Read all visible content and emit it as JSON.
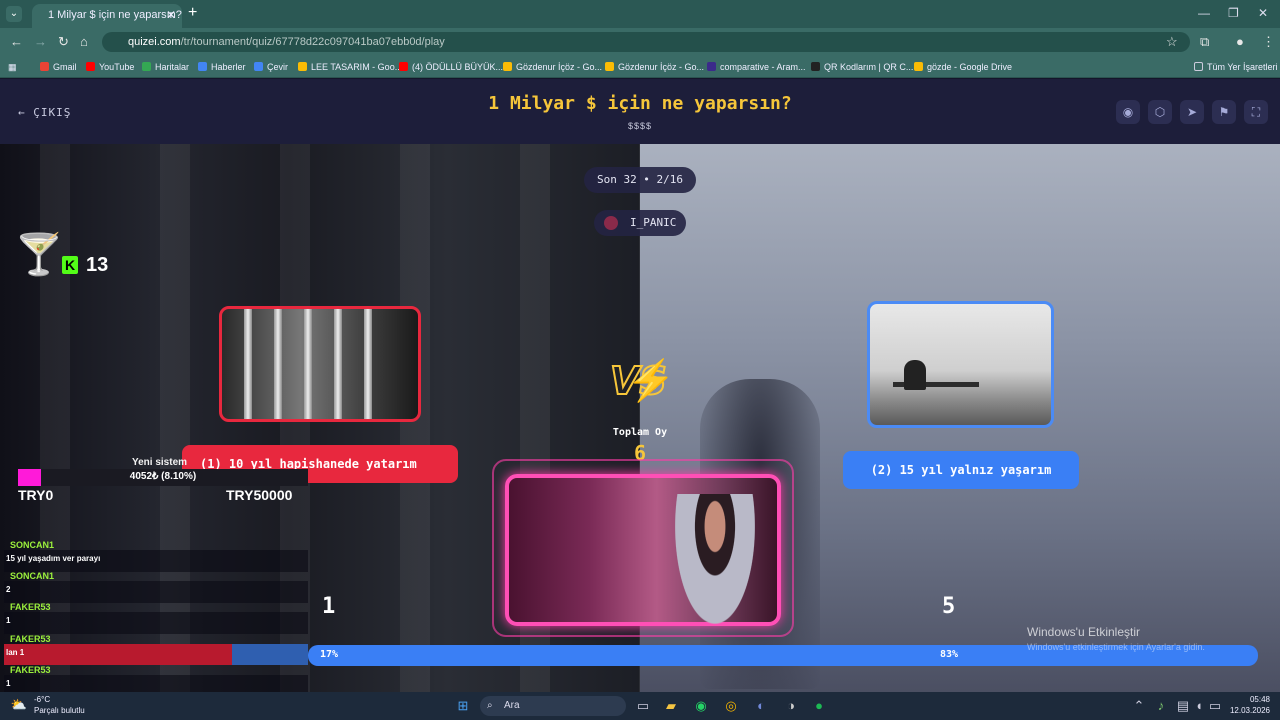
{
  "browser": {
    "tab_title": "1 Milyar $ için ne yaparsın? - Ti",
    "tab_close": "✕",
    "new_tab": "+",
    "url_host": "quizei.com",
    "url_path": "/tr/tournament/quiz/67778d22c097041ba07ebb0d/play",
    "bookmarks": [
      "Gmail",
      "YouTube",
      "Haritalar",
      "Haberler",
      "Çevir",
      "LEE TASARIM - Goo...",
      "(4) ÖDÜLLÜ BÜYÜK...",
      "Gözdenur İçöz - Go...",
      "Gözdenur İçöz - Go...",
      "comparative - Aram...",
      "QR Kodlarım | QR C...",
      "gözde - Google Drive"
    ],
    "all_bookmarks": "Tüm Yer İşaretleri"
  },
  "header": {
    "exit_label": "ÇIKIŞ",
    "title": "1 Milyar $ için ne yaparsın?",
    "subtitle": "$$$$"
  },
  "round": {
    "label": "Son 32 • 2/16",
    "player": "I_PANIC"
  },
  "vs": {
    "text": "VS",
    "total_label": "Toplam Oy",
    "total_value": "6"
  },
  "options": {
    "left_label": "(1) 10 yıl hapishanede yatarım",
    "right_label": "(2) 15 yıl yalnız yaşarım",
    "left_votes": "1",
    "right_votes": "5",
    "left_pct": "17%",
    "right_pct": "83%",
    "left_fraction": 0.17
  },
  "stream_overlay": {
    "kick_count": "13",
    "donate_title": "Yeni sistem",
    "donate_text": "4052₺ (8.10%)",
    "donate_fraction": 0.081,
    "min_label": "TRY0",
    "max_label": "TRY50000",
    "chat": [
      {
        "user": "SONCAN1",
        "msg": "15 yıl yaşadım ver parayı"
      },
      {
        "user": "SONCAN1",
        "msg": "2"
      },
      {
        "user": "FAKER53",
        "msg": "1"
      },
      {
        "user": "FAKER53",
        "msg": "lan 1"
      },
      {
        "user": "FAKER53",
        "msg": "1"
      }
    ]
  },
  "windows": {
    "activate_title": "Windows'u Etkinleştir",
    "activate_sub": "Windows'u etkinleştirmek için Ayarlar'a gidin.",
    "search_placeholder": "Ara",
    "temp": "-6°C",
    "weather": "Parçalı bulutlu",
    "time": "05:48",
    "date": "12.03.2026"
  }
}
